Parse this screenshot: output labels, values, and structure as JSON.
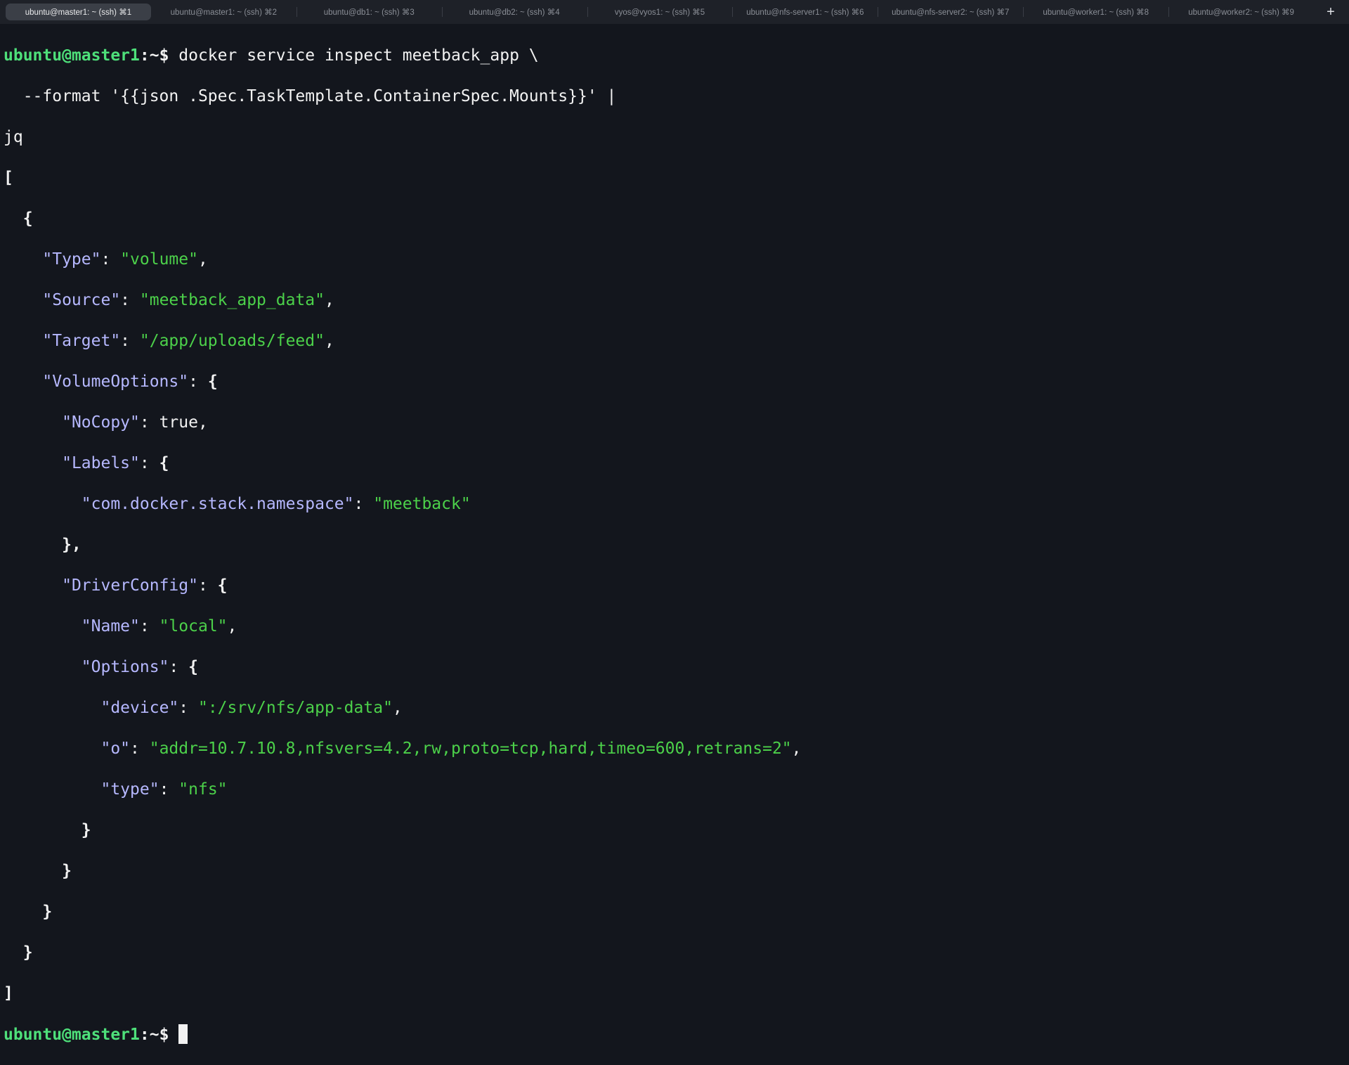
{
  "tabs": [
    {
      "label": "ubuntu@master1: ~ (ssh) ⌘1",
      "active": true
    },
    {
      "label": "ubuntu@master1: ~ (ssh) ⌘2",
      "active": false
    },
    {
      "label": "ubuntu@db1: ~ (ssh) ⌘3",
      "active": false
    },
    {
      "label": "ubuntu@db2: ~ (ssh) ⌘4",
      "active": false
    },
    {
      "label": "vyos@vyos1: ~ (ssh) ⌘5",
      "active": false
    },
    {
      "label": "ubuntu@nfs-server1: ~ (ssh) ⌘6",
      "active": false
    },
    {
      "label": "ubuntu@nfs-server2: ~ (ssh) ⌘7",
      "active": false
    },
    {
      "label": "ubuntu@worker1: ~ (ssh) ⌘8",
      "active": false
    },
    {
      "label": "ubuntu@worker2: ~ (ssh) ⌘9",
      "active": false
    }
  ],
  "new_tab_label": "+",
  "terminal": {
    "prompt": "ubuntu@master1",
    "prompt_suffix": ":~$",
    "command_line1": " docker service inspect meetback_app \\",
    "command_line2": "  --format '{{json .Spec.TaskTemplate.ContainerSpec.Mounts}}' |",
    "command_line3": "jq",
    "json": {
      "type_key": "\"Type\"",
      "type_val": "\"volume\"",
      "source_key": "\"Source\"",
      "source_val": "\"meetback_app_data\"",
      "target_key": "\"Target\"",
      "target_val": "\"/app/uploads/feed\"",
      "volopts_key": "\"VolumeOptions\"",
      "nocopy_key": "\"NoCopy\"",
      "nocopy_val": "true",
      "labels_key": "\"Labels\"",
      "ns_key": "\"com.docker.stack.namespace\"",
      "ns_val": "\"meetback\"",
      "driver_key": "\"DriverConfig\"",
      "name_key": "\"Name\"",
      "name_val": "\"local\"",
      "options_key": "\"Options\"",
      "device_key": "\"device\"",
      "device_val": "\":/srv/nfs/app-data\"",
      "o_key": "\"o\"",
      "o_val": "\"addr=10.7.10.8,nfsvers=4.2,rw,proto=tcp,hard,timeo=600,retrans=2\"",
      "typ_key": "\"type\"",
      "typ_val": "\"nfs\""
    }
  },
  "colors": {
    "background": "#13161d",
    "prompt": "#4ee07a",
    "json_key": "#b6b8ff",
    "json_string": "#4cd14a"
  }
}
